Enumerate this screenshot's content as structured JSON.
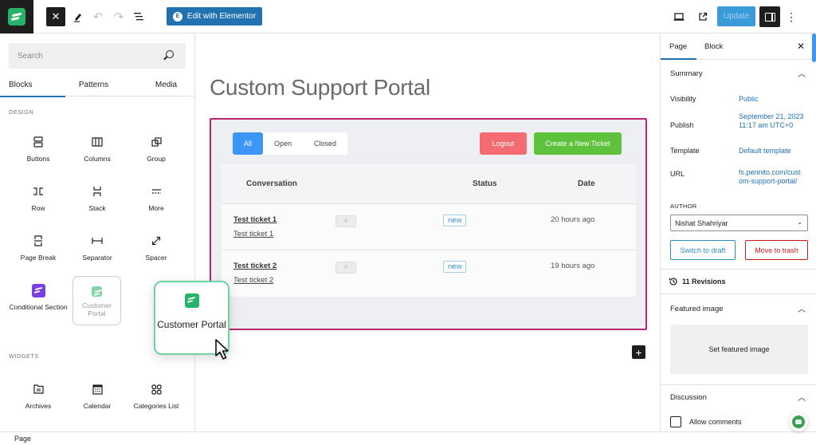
{
  "topbar": {
    "close_icon": "close-icon",
    "tools": [
      "pencil-icon",
      "undo-icon",
      "redo-icon",
      "list-view-icon"
    ],
    "elementor_label": "Edit with Elementor",
    "elementor_icon": "E",
    "right_tools": [
      "desktop-preview-icon",
      "external-view-icon"
    ],
    "update_label": "Update",
    "colors": {
      "primary": "#2271b1",
      "update": "#3a9bd9"
    }
  },
  "inserter": {
    "search": {
      "placeholder": "Search",
      "value": ""
    },
    "tabs": [
      {
        "label": "Blocks",
        "active": true
      },
      {
        "label": "Patterns",
        "active": false
      },
      {
        "label": "Media",
        "active": false
      }
    ],
    "design_label": "DESIGN",
    "design_blocks": [
      {
        "label": "Buttons",
        "icon": "buttons-icon"
      },
      {
        "label": "Columns",
        "icon": "columns-icon"
      },
      {
        "label": "Group",
        "icon": "group-icon"
      },
      {
        "label": "Row",
        "icon": "row-icon"
      },
      {
        "label": "Stack",
        "icon": "stack-icon"
      },
      {
        "label": "More",
        "icon": "more-icon"
      },
      {
        "label": "Page Break",
        "icon": "page-break-icon"
      },
      {
        "label": "Separator",
        "icon": "separator-icon"
      },
      {
        "label": "Spacer",
        "icon": "spacer-icon"
      },
      {
        "label": "Conditional Section",
        "icon": "conditional-section-icon"
      },
      {
        "label": "Customer Portal",
        "icon": "customer-portal-icon"
      }
    ],
    "widgets_label": "WIDGETS",
    "widget_blocks": [
      {
        "label": "Archives",
        "icon": "archives-icon"
      },
      {
        "label": "Calendar",
        "icon": "calendar-icon"
      },
      {
        "label": "Categories List",
        "icon": "categories-list-icon"
      }
    ],
    "drag_card_label": "Customer Portal"
  },
  "canvas": {
    "page_title": "Custom Support Portal",
    "portal": {
      "filters": [
        "All",
        "Open",
        "Closed"
      ],
      "active_filter": "All",
      "logout_label": "Logout",
      "new_ticket_label": "Create a New Ticket",
      "columns": [
        "Conversation",
        "Status",
        "Date"
      ],
      "tickets": [
        {
          "title": "Test ticket 1",
          "subtitle": "Test ticket 1",
          "count": "0",
          "status": "new",
          "date": "20 hours ago"
        },
        {
          "title": "Test ticket 2",
          "subtitle": "Test ticket 2",
          "count": "0",
          "status": "new",
          "date": "19 hours ago"
        }
      ],
      "colors": {
        "border": "#b5266f",
        "all": "#3d96f5",
        "logout": "#f46c72",
        "new_ticket": "#5ec23d"
      }
    },
    "add_block_label": "+"
  },
  "sidebar": {
    "tabs": [
      {
        "label": "Page",
        "active": true
      },
      {
        "label": "Block",
        "active": false
      }
    ],
    "summary": {
      "title": "Summary",
      "visibility_label": "Visibility",
      "visibility_value": "Public",
      "publish_label": "Publish",
      "publish_value": "September 21, 2023 11:17 am UTC+0",
      "template_label": "Template",
      "template_value": "Default template",
      "url_label": "URL",
      "url_value": "fs.pennito.com/custom-support-portal/",
      "author_label": "AUTHOR",
      "author_value": "Nishat Shahriyar",
      "switch_draft_label": "Switch to draft",
      "move_trash_label": "Move to trash"
    },
    "revisions_label": "11 Revisions",
    "featured_image": {
      "title": "Featured image",
      "button_label": "Set featured image"
    },
    "discussion": {
      "title": "Discussion",
      "allow_comments_label": "Allow comments",
      "allow_comments_checked": false
    }
  },
  "footer": {
    "breadcrumb": "Page"
  }
}
